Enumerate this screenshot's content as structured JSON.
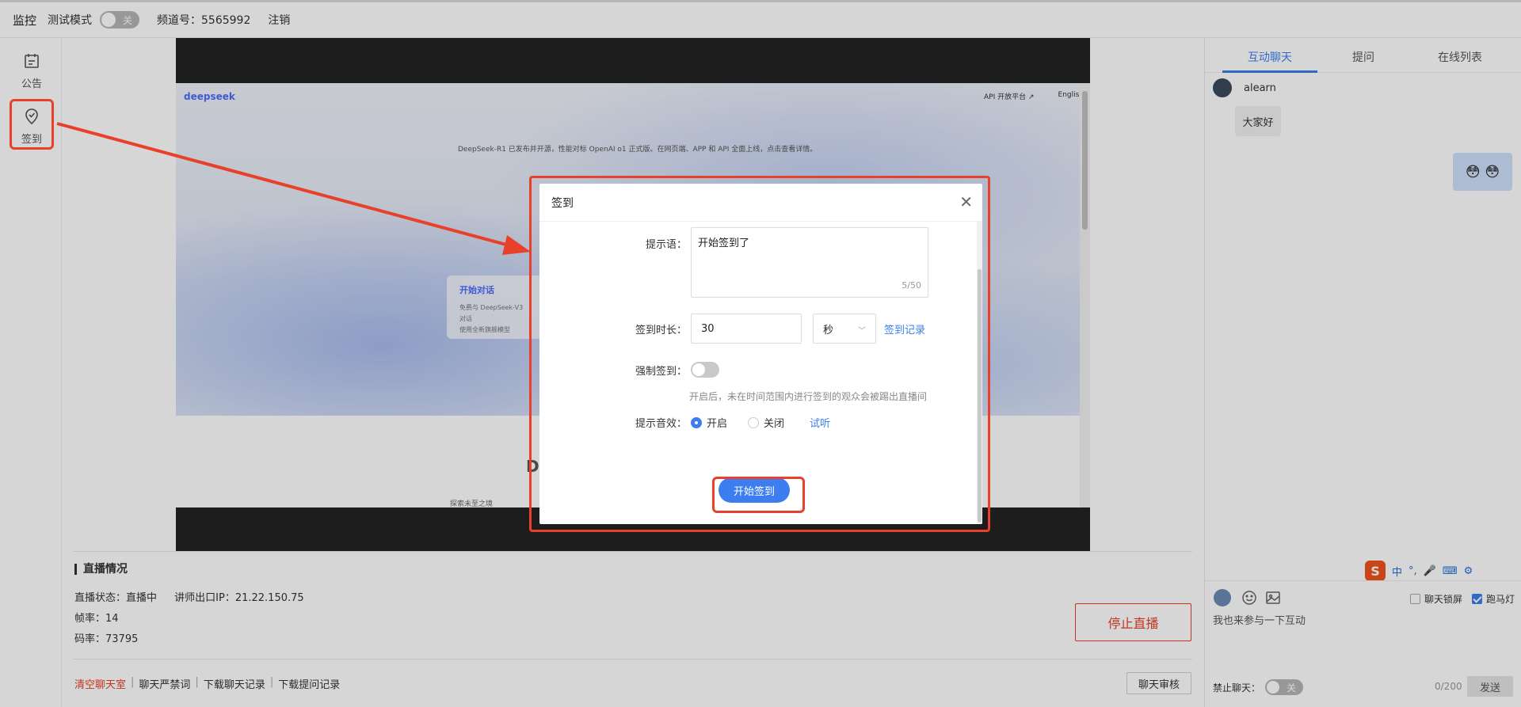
{
  "topbar": {
    "monitor": "监控",
    "test_mode": "测试模式",
    "toggle_off": "关",
    "channel": "频道号：5565992",
    "logout": "注销"
  },
  "leftnav": {
    "items": [
      {
        "label": "公告",
        "icon": "calendar-icon"
      },
      {
        "label": "签到",
        "icon": "shield-check-icon"
      }
    ]
  },
  "screen": {
    "logo": "deepseek",
    "api": "API 开放平台 ↗",
    "english": "English",
    "news": "DeepSeek-R1 已发布并开源，性能对标 OpenAI o1 正式版。在网页端、APP 和 API 全面上线，点击查看详情。",
    "card_title": "开始对话",
    "card_line1": "免费与 DeepSeek-V3 对话",
    "card_line2": "使用全新旗舰模型",
    "big_letter": "D",
    "sub": "探索未至之境"
  },
  "modal": {
    "title": "签到",
    "prompt_label": "提示语：",
    "prompt_value": "开始签到了",
    "prompt_count": "5/50",
    "duration_label": "签到时长：",
    "duration_value": "30",
    "unit": "秒",
    "record_link": "签到记录",
    "force_label": "强制签到：",
    "force_hint": "开启后，未在时间范围内进行签到的观众会被踢出直播间",
    "sound_label": "提示音效：",
    "sound_on": "开启",
    "sound_off": "关闭",
    "try_listen": "试听",
    "start_button": "开始签到"
  },
  "status": {
    "title": "直播情况",
    "state": "直播状态：直播中",
    "ip": "讲师出口IP：21.22.150.75",
    "fps": "帧率：14",
    "bitrate": "码率：73795",
    "stop_button": "停止直播"
  },
  "footer": {
    "clear_chat": "清空聊天室",
    "chat_ban_words": "聊天严禁词",
    "download_chat": "下载聊天记录",
    "download_questions": "下载提问记录",
    "chat_audit": "聊天审核"
  },
  "chat": {
    "tabs": [
      "互动聊天",
      "提问",
      "在线列表"
    ],
    "user": "alearn",
    "message": "大家好",
    "emoji_reply": "😳 😳",
    "ime": {
      "logo": "S",
      "cn": "中",
      "punct": "°,",
      "mic": "🎤",
      "kb": "⌨",
      "more": "⚙"
    },
    "lock_screen": "聊天锁屏",
    "marquee": "跑马灯",
    "composer_placeholder": "我也来参与一下互动",
    "ban_chat": "禁止聊天：",
    "toggle_off": "关",
    "counter": "0/200",
    "send": "发送"
  },
  "colors": {
    "accent": "#3c7ef0",
    "danger": "#e8402a"
  }
}
